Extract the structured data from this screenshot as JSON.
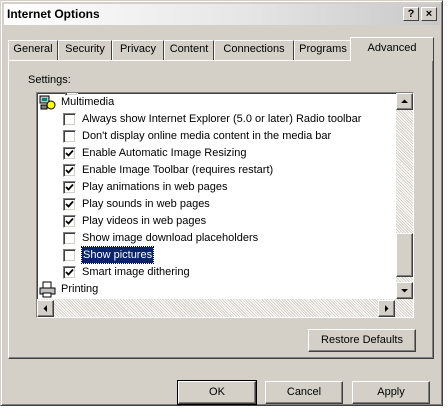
{
  "window": {
    "title": "Internet Options",
    "help_btn": "?",
    "close_btn": "×"
  },
  "tabs": [
    "General",
    "Security",
    "Privacy",
    "Content",
    "Connections",
    "Programs",
    "Advanced"
  ],
  "active_tab": "Advanced",
  "settings_label": "Settings:",
  "list": {
    "multimedia_label": "Multimedia",
    "printing_label": "Printing",
    "items": [
      {
        "label": "Always show Internet Explorer (5.0 or later) Radio toolbar",
        "checked": false
      },
      {
        "label": "Don't display online media content in the media bar",
        "checked": false
      },
      {
        "label": "Enable Automatic Image Resizing",
        "checked": true
      },
      {
        "label": "Enable Image Toolbar (requires restart)",
        "checked": true
      },
      {
        "label": "Play animations in web pages",
        "checked": true
      },
      {
        "label": "Play sounds in web pages",
        "checked": true
      },
      {
        "label": "Play videos in web pages",
        "checked": true
      },
      {
        "label": "Show image download placeholders",
        "checked": false
      },
      {
        "label": "Show pictures",
        "checked": false,
        "selected": true
      },
      {
        "label": "Smart image dithering",
        "checked": true
      }
    ]
  },
  "buttons": {
    "restore": "Restore Defaults",
    "ok": "OK",
    "cancel": "Cancel",
    "apply": "Apply"
  }
}
